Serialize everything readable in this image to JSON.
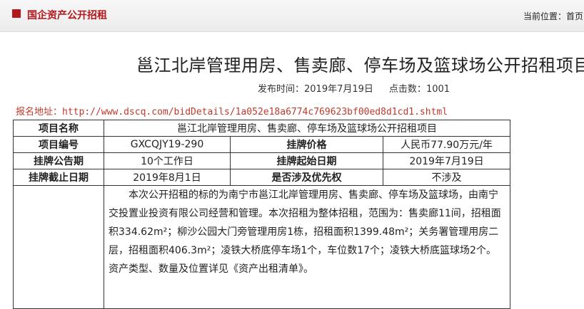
{
  "header": {
    "section_title": "国企资产公开招租",
    "location_label": "当前位置：",
    "location_home": "首页"
  },
  "article": {
    "title": "邕江北岸管理用房、售卖廊、停车场及篮球场公开招租项目",
    "publish_label": "发布时间：",
    "publish_date": "2019年7月19日",
    "clicks_label": "点击数：",
    "clicks": "1001",
    "reg_label": "报名地址：",
    "reg_url": "http://www.dscq.com/bidDetails/1a052e18a6774c769623bf00ed8d1cd1.shtml"
  },
  "table": {
    "name_label": "项目名称",
    "name_value": "邕江北岸管理用房、售卖廊、停车场及篮球场公开招租项目",
    "code_label": "项目编号",
    "code_value": "GXCQJY19-290",
    "price_label": "挂牌价格",
    "price_value": "人民币77.90万元/年",
    "period_label": "挂牌公告期",
    "period_value": "10个工作日",
    "start_label": "挂牌起始日期",
    "start_value": "2019年7月19日",
    "end_label": "挂牌截止日期",
    "end_value": "2019年8月1日",
    "priority_label": "是否涉及优先权",
    "priority_value": "不涉及",
    "description": "本次公开招租的标的为南宁市邕江北岸管理用房、售卖廊、停车场及篮球场，由南宁交投置业投资有限公司经营和管理。本次招租为整体招租，范围为：售卖廊11间，招租面积334.62m²；柳沙公园大门旁管理用房1栋，招租面积1399.48m²；关务署管理用房二层，招租面积406.3m²；凌铁大桥底停车场1个，车位数17个；凌铁大桥底篮球场2个。资产类型、数量及位置详见《资产出租清单》。"
  }
}
